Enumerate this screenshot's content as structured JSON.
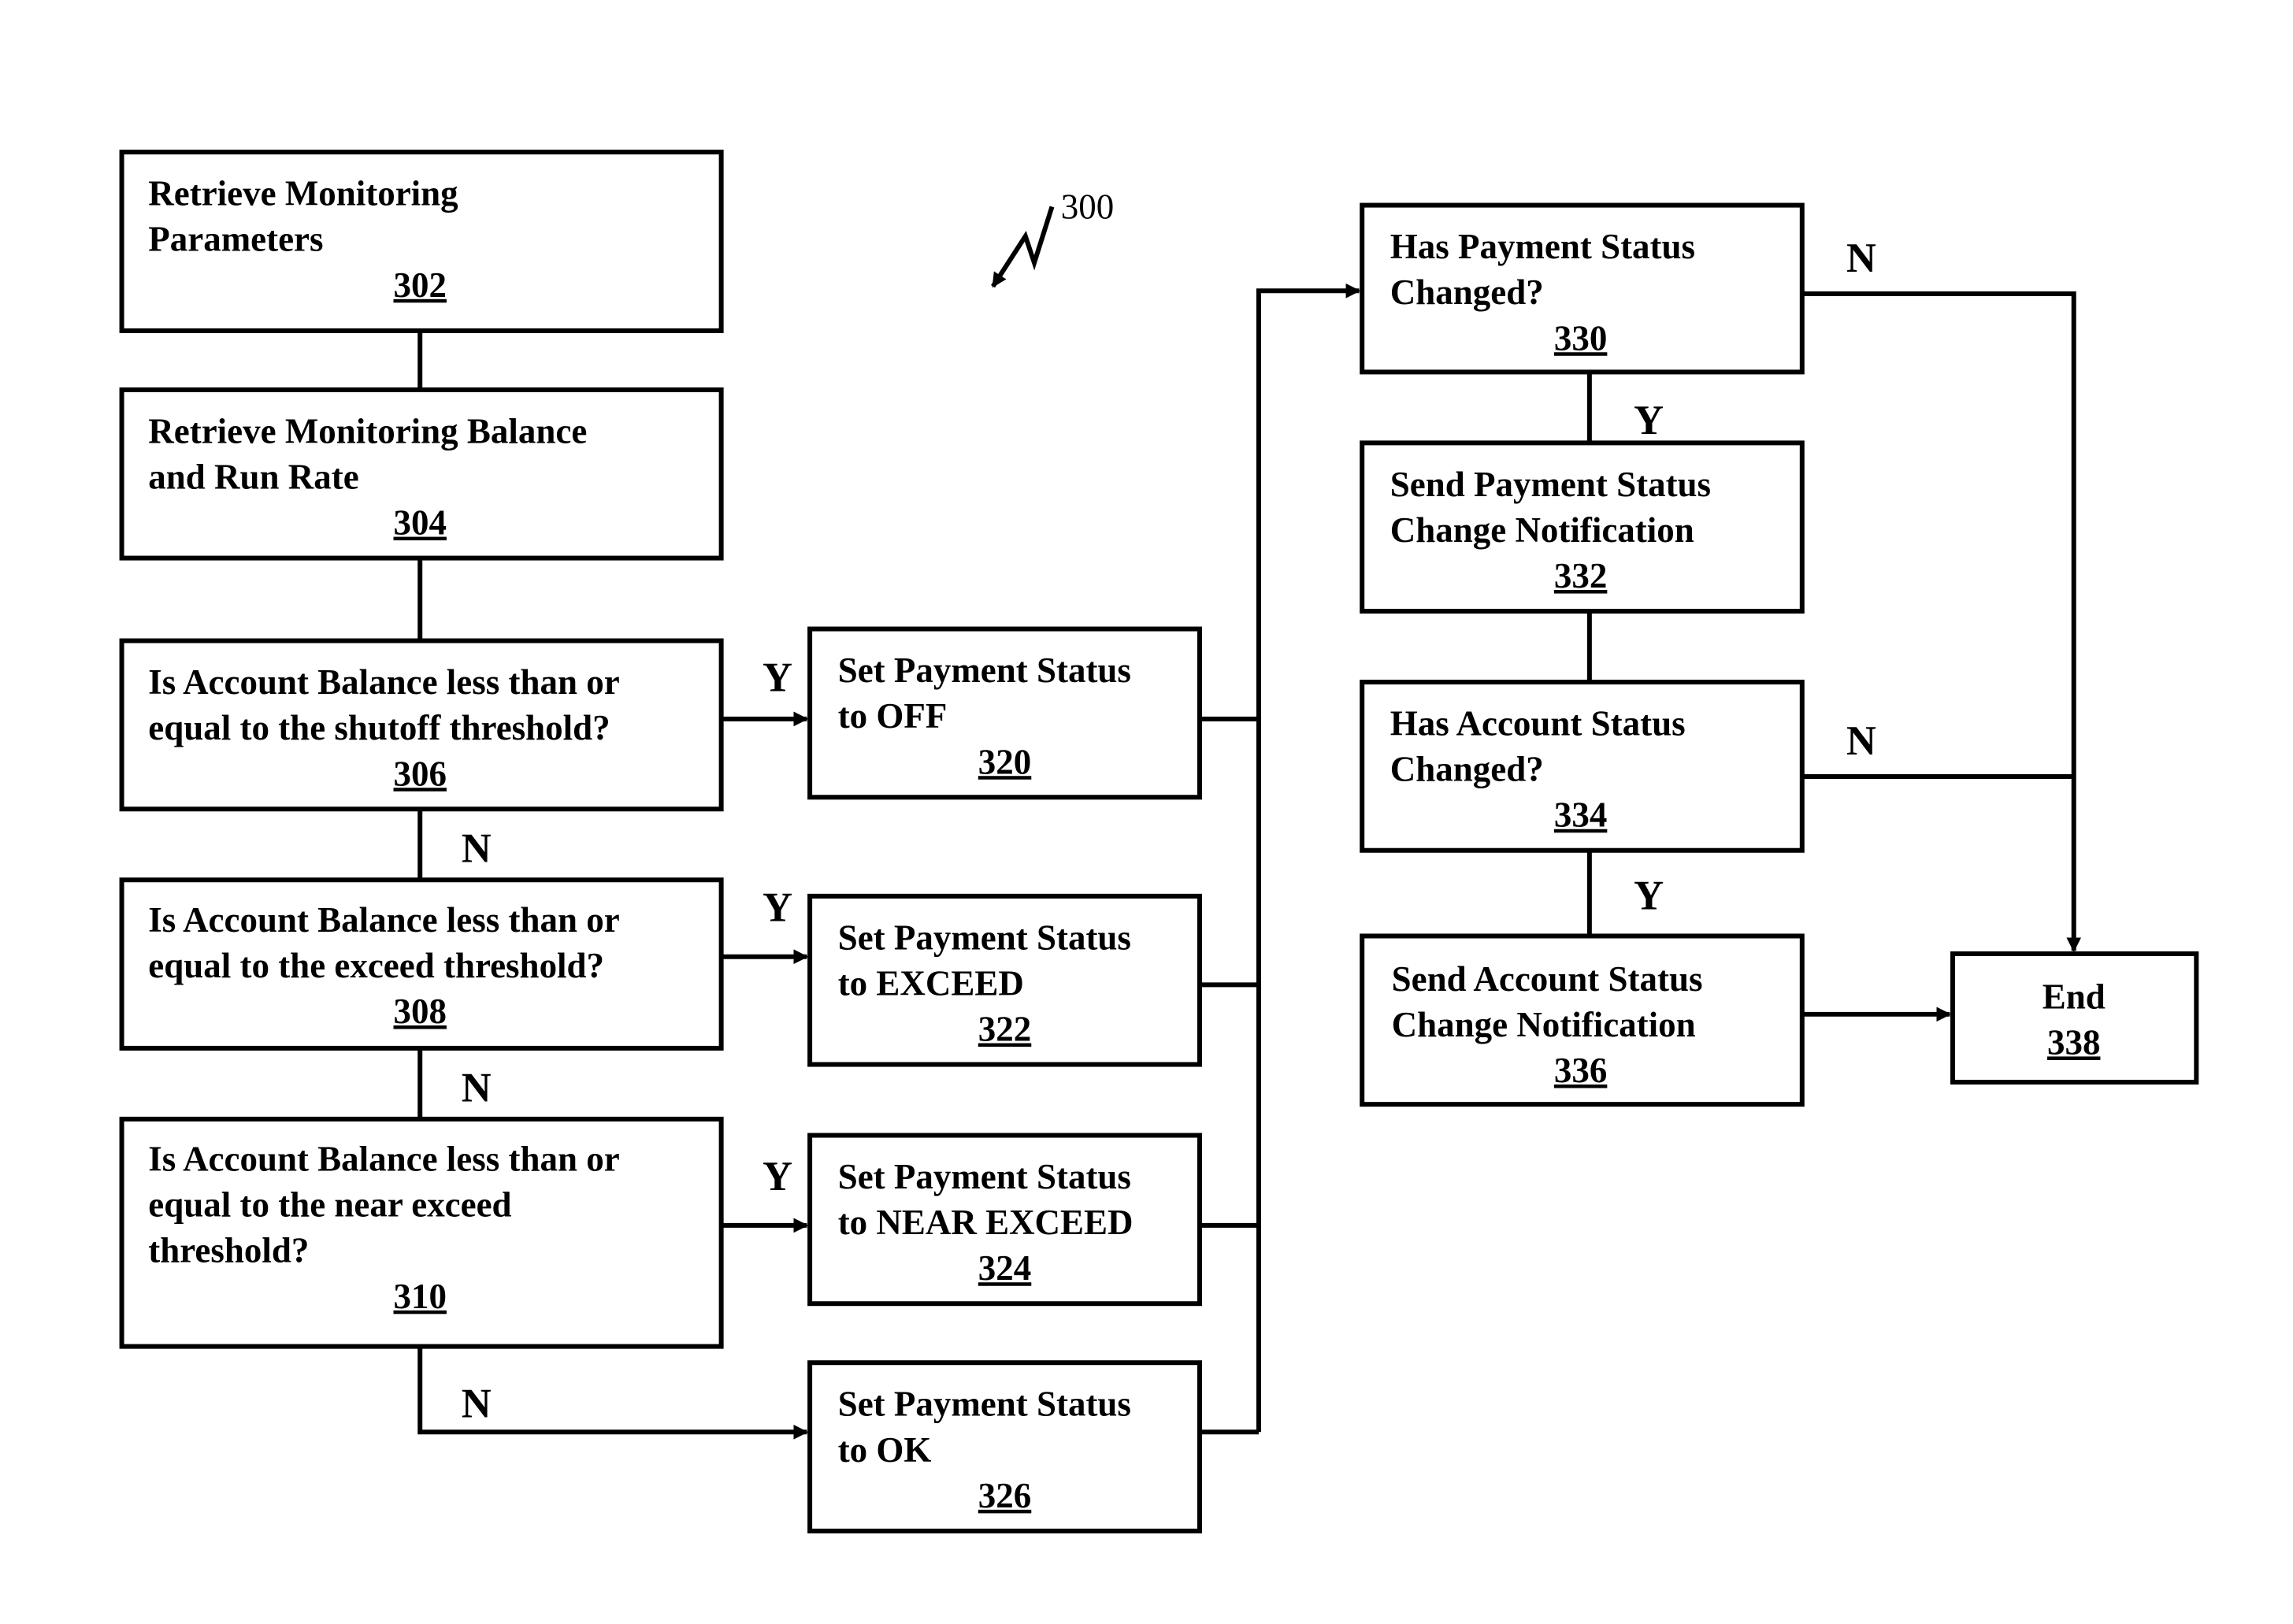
{
  "figure_number": "300",
  "nodes": {
    "n302": {
      "lines": [
        "Retrieve Monitoring",
        "Parameters"
      ],
      "ref": "302"
    },
    "n304": {
      "lines": [
        "Retrieve Monitoring Balance",
        "and Run Rate"
      ],
      "ref": "304"
    },
    "n306": {
      "lines": [
        "Is Account Balance less than or",
        "equal to the shutoff threshold?"
      ],
      "ref": "306"
    },
    "n308": {
      "lines": [
        "Is Account Balance less than or",
        "equal to the exceed threshold?"
      ],
      "ref": "308"
    },
    "n310": {
      "lines": [
        "Is Account Balance less than or",
        "equal to the near exceed",
        "threshold?"
      ],
      "ref": "310"
    },
    "n320": {
      "lines": [
        "Set Payment Status",
        "to OFF"
      ],
      "ref": "320"
    },
    "n322": {
      "lines": [
        "Set Payment Status",
        "to EXCEED"
      ],
      "ref": "322"
    },
    "n324": {
      "lines": [
        "Set Payment Status",
        "to NEAR EXCEED"
      ],
      "ref": "324"
    },
    "n326": {
      "lines": [
        "Set Payment Status",
        "to OK"
      ],
      "ref": "326"
    },
    "n330": {
      "lines": [
        "Has Payment Status",
        "Changed?"
      ],
      "ref": "330"
    },
    "n332": {
      "lines": [
        "Send Payment Status",
        "Change Notification"
      ],
      "ref": "332"
    },
    "n334": {
      "lines": [
        "Has Account Status",
        "Changed?"
      ],
      "ref": "334"
    },
    "n336": {
      "lines": [
        "Send Account Status",
        "Change Notification"
      ],
      "ref": "336"
    },
    "n338": {
      "lines": [
        "End"
      ],
      "ref": "338"
    }
  },
  "edge_labels": {
    "y306": "Y",
    "n306": "N",
    "y308": "Y",
    "n308": "N",
    "y310": "Y",
    "n310": "N",
    "n330": "N",
    "y330": "Y",
    "n334": "N",
    "y334": "Y"
  }
}
